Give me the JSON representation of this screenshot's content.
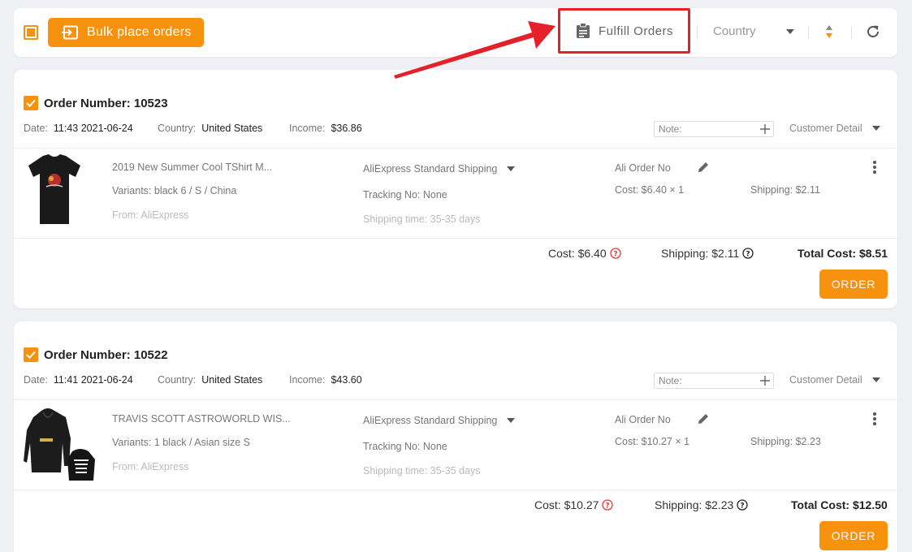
{
  "toolbar": {
    "bulk_label": "Bulk place orders",
    "fulfill_label": "Fulfill Orders",
    "country_label": "Country"
  },
  "orders": [
    {
      "title": "Order Number: 10523",
      "date_label": "Date:",
      "date": "11:43 2021-06-24",
      "country_label": "Country:",
      "country": "United States",
      "income_label": "Income:",
      "income": "$36.86",
      "note_placeholder": "Note:",
      "customer_detail": "Customer Detail",
      "product_title": "2019 New Summer Cool TShirt M...",
      "variants": "Variants: black 6 / S / China",
      "from": "From: AliExpress",
      "shipping_method": "AliExpress Standard Shipping",
      "tracking": "Tracking No: None",
      "shipping_time": "Shipping time: 35-35 days",
      "ali_order_no": "Ali Order No",
      "unit_cost": "Cost: $6.40 × 1",
      "unit_shipping": "Shipping: $2.11",
      "cost_total": "Cost: $6.40",
      "shipping_total": "Shipping: $2.11",
      "total_cost": "Total Cost: $8.51",
      "order_label": "ORDER"
    },
    {
      "title": "Order Number: 10522",
      "date_label": "Date:",
      "date": "11:41 2021-06-24",
      "country_label": "Country:",
      "country": "United States",
      "income_label": "Income:",
      "income": "$43.60",
      "note_placeholder": "Note:",
      "customer_detail": "Customer Detail",
      "product_title": "TRAVIS SCOTT ASTROWORLD WIS...",
      "variants": "Variants: 1 black / Asian size S",
      "from": "From: AliExpress",
      "shipping_method": "AliExpress Standard Shipping",
      "tracking": "Tracking No: None",
      "shipping_time": "Shipping time: 35-35 days",
      "ali_order_no": "Ali Order No",
      "unit_cost": "Cost: $10.27 × 1",
      "unit_shipping": "Shipping: $2.23",
      "cost_total": "Cost: $10.27",
      "shipping_total": "Shipping: $2.23",
      "total_cost": "Total Cost: $12.50",
      "order_label": "ORDER"
    }
  ],
  "colors": {
    "accent": "#f7920f",
    "highlight": "#e6202a",
    "error": "#e53935"
  }
}
